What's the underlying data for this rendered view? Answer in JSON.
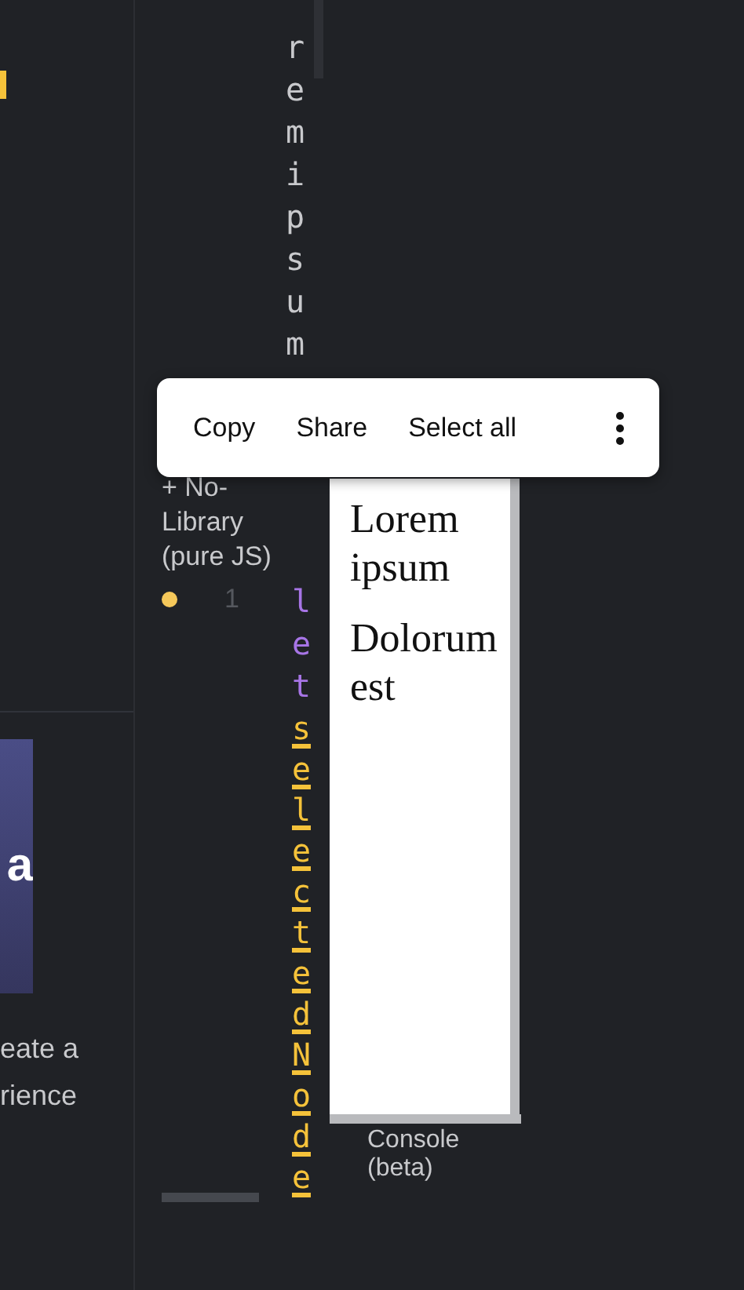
{
  "left_panel": {
    "card_letter": "a",
    "text_lines": [
      "eate a",
      "rience"
    ]
  },
  "editor_top": {
    "code": "remipsum"
  },
  "library": {
    "label": "+ No-Library (pure JS)",
    "line_number": "1"
  },
  "code": {
    "keyword": "let",
    "identifier": "selectedNode"
  },
  "preview": {
    "paragraphs": [
      "Lorem ipsum",
      "Dolorum est"
    ]
  },
  "console": {
    "label": "Console (beta)"
  },
  "context_menu": {
    "items": [
      "Copy",
      "Share",
      "Select all"
    ]
  }
}
